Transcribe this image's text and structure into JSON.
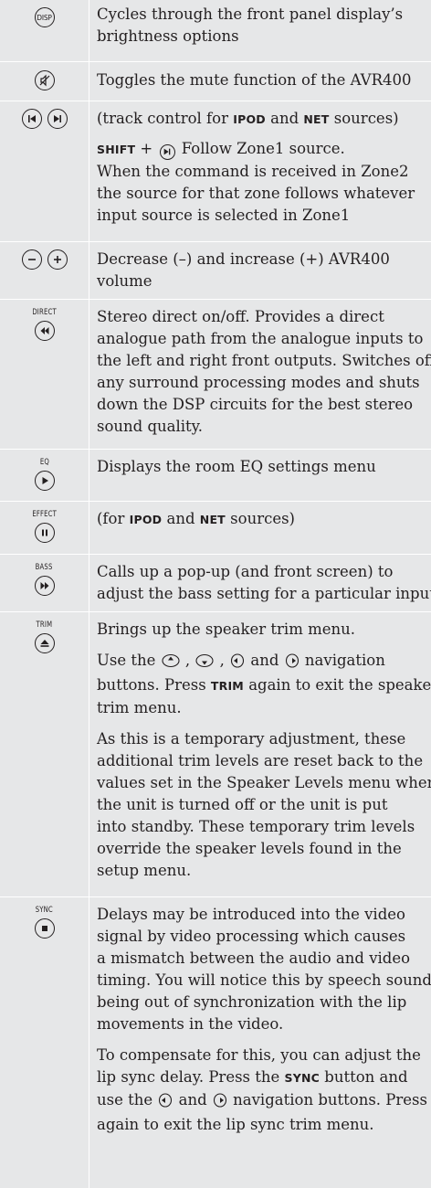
{
  "rows": [
    {
      "icon": "disp-button-icon",
      "button_label": "DISP",
      "lines": [
        "Cycles through the front panel display’s",
        "brightness options"
      ]
    },
    {
      "icon": "mute-button-icon",
      "lines": [
        "Toggles the mute function of the AVR400"
      ]
    },
    {
      "icon": "track-previous-next-icons",
      "p1": {
        "pre": "(track control for ",
        "kw1": "IPOD",
        "mid": " and ",
        "kw2": "NET",
        "post": " sources)"
      },
      "p2": {
        "kw": "SHIFT",
        "plus": " + ",
        "after": " Follow Zone1 source.",
        "lines": [
          "When the command is received in Zone2",
          "the source for that zone follows whatever",
          "input source is selected in Zone1"
        ]
      }
    },
    {
      "icon": "volume-minus-plus-icons",
      "lines": [
        "Decrease (–) and increase (+) AVR400",
        "volume"
      ]
    },
    {
      "caption": "DIRECT",
      "icon": "rewind-button-icon",
      "lines": [
        "Stereo direct on/off. Provides a direct",
        "analogue path from the analogue inputs to",
        "the left and right front outputs. Switches off",
        "any surround processing modes and shuts",
        "down the DSP circuits for the best stereo",
        "sound quality."
      ]
    },
    {
      "caption": "EQ",
      "icon": "play-button-icon",
      "lines": [
        "Displays the room EQ settings menu"
      ]
    },
    {
      "caption": "EFFECT",
      "icon": "pause-button-icon",
      "p1": {
        "pre": "(for ",
        "kw1": "IPOD",
        "mid": " and ",
        "kw2": "NET",
        "post": " sources)"
      }
    },
    {
      "caption": "BASS",
      "icon": "fast-forward-button-icon",
      "lines": [
        "Calls up a pop-up (and front screen) to",
        "adjust the bass setting for a particular input."
      ]
    },
    {
      "caption": "TRIM",
      "icon": "eject-button-icon",
      "p1_text": "Brings up the speaker trim menu.",
      "p2": {
        "pre": "Use the ",
        "sep1": " , ",
        "sep2": " , ",
        "and": " and ",
        "post": " navigation",
        "line2_pre": "buttons. Press ",
        "kw": "TRIM",
        "line2_post": " again to exit the speaker",
        "line3": "trim menu."
      },
      "p3_lines": [
        "As this is a temporary adjustment, these",
        "additional trim levels are reset back to the",
        "values set in the Speaker Levels menu when",
        "the unit is turned off or the unit is put",
        "into standby. These temporary trim levels",
        "override the speaker levels found in the",
        "setup menu."
      ]
    },
    {
      "caption": "SYNC",
      "icon": "stop-button-icon",
      "p1_lines": [
        "Delays may be introduced into the video",
        "signal by video processing which causes",
        "a mismatch between the audio and video",
        "timing. You will notice this by speech sound",
        "being out of synchronization with the lip",
        "movements in the video."
      ],
      "p2": {
        "line1": "To compensate for this, you can adjust the",
        "line2_pre": "lip sync delay. Press the ",
        "kw": "SYNC",
        "line2_post": " button and",
        "line3_pre": "use the ",
        "and": " and ",
        "line3_post": " navigation buttons. Press",
        "line4": "again to exit the lip sync trim menu."
      }
    }
  ]
}
